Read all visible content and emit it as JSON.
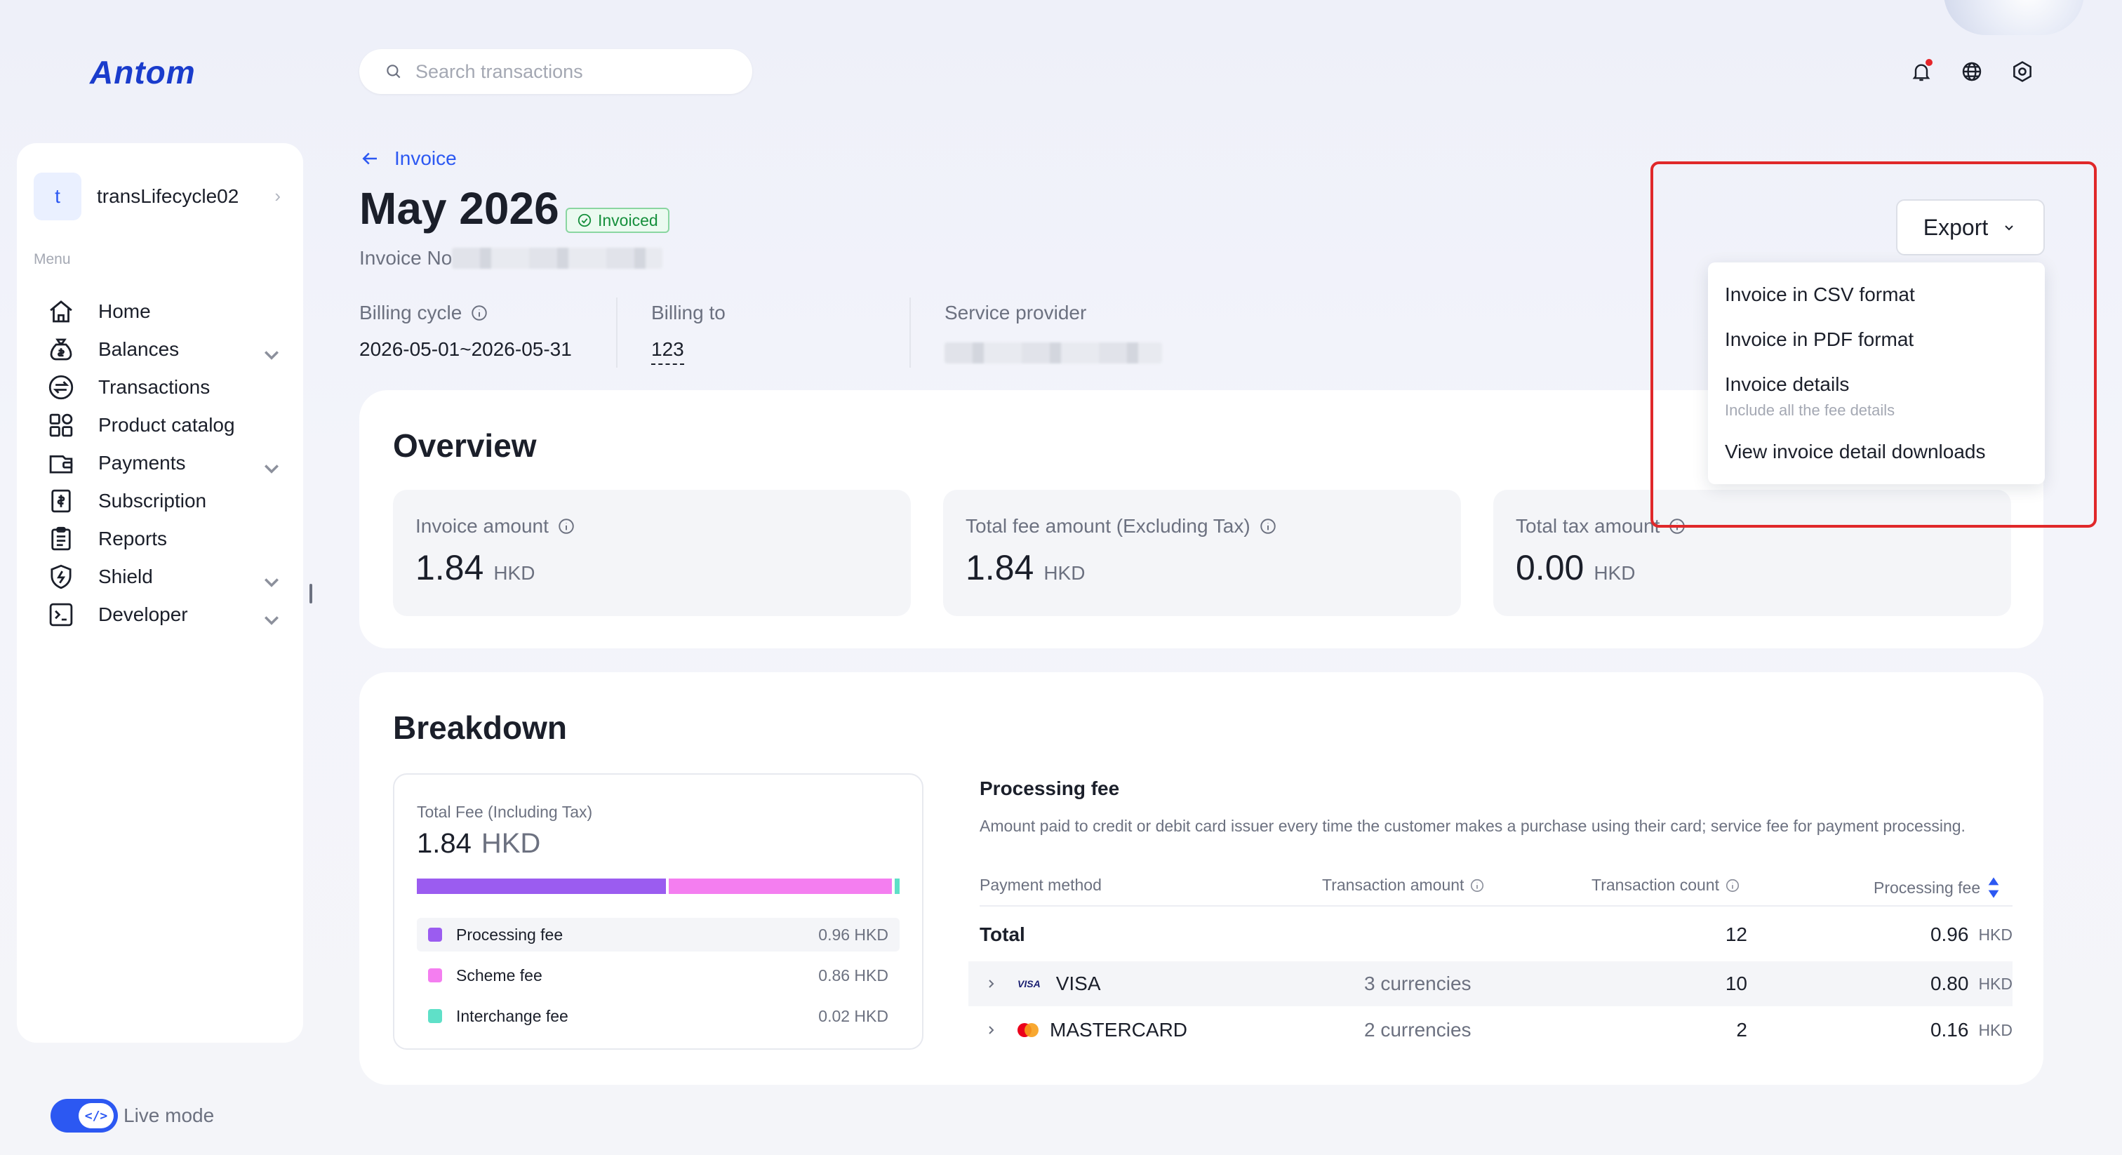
{
  "app": {
    "logo_text": "Antom"
  },
  "header": {
    "search_placeholder": "Search transactions",
    "icons": [
      "bell-icon",
      "globe-icon",
      "gear-icon"
    ]
  },
  "sidebar": {
    "account_initial": "t",
    "account_name": "transLifecycle02",
    "menu_label": "Menu",
    "items": [
      {
        "label": "Home",
        "icon": "home-icon",
        "expandable": false
      },
      {
        "label": "Balances",
        "icon": "balances-icon",
        "expandable": true
      },
      {
        "label": "Transactions",
        "icon": "transactions-icon",
        "expandable": false
      },
      {
        "label": "Product catalog",
        "icon": "catalog-icon",
        "expandable": false
      },
      {
        "label": "Payments",
        "icon": "payments-icon",
        "expandable": true
      },
      {
        "label": "Subscription",
        "icon": "subscription-icon",
        "expandable": false
      },
      {
        "label": "Reports",
        "icon": "reports-icon",
        "expandable": false
      },
      {
        "label": "Shield",
        "icon": "shield-icon",
        "expandable": true
      },
      {
        "label": "Developer",
        "icon": "developer-icon",
        "expandable": true
      }
    ],
    "live_mode_label": "Live mode",
    "live_mode_on": true
  },
  "page": {
    "back_label": "Invoice",
    "title": "May 2026",
    "status_badge": "Invoiced",
    "invoice_no_label": "Invoice No",
    "billing_cycle_label": "Billing cycle",
    "billing_cycle_value": "2026-05-01~2026-05-31",
    "billing_to_label": "Billing to",
    "billing_to_value": "123",
    "service_provider_label": "Service provider"
  },
  "export": {
    "button_label": "Export",
    "menu": [
      {
        "label": "Invoice in CSV format"
      },
      {
        "label": "Invoice in PDF format"
      },
      {
        "label": "Invoice details",
        "sublabel": "Include all the fee details"
      },
      {
        "label": "View invoice detail downloads"
      }
    ]
  },
  "overview": {
    "title": "Overview",
    "stats": [
      {
        "label": "Invoice amount",
        "value": "1.84",
        "currency": "HKD"
      },
      {
        "label": "Total fee amount (Excluding Tax)",
        "value": "1.84",
        "currency": "HKD"
      },
      {
        "label": "Total tax amount",
        "value": "0.00",
        "currency": "HKD"
      }
    ]
  },
  "breakdown": {
    "title": "Breakdown",
    "total_fee_label": "Total Fee (Including Tax)",
    "total_fee_value": "1.84",
    "total_fee_currency": "HKD",
    "fees": [
      {
        "name": "Processing fee",
        "amount": "0.96 HKD",
        "share": 0.5217,
        "color": "#9b5cf0"
      },
      {
        "name": "Scheme fee",
        "amount": "0.86 HKD",
        "share": 0.4674,
        "color": "#f47ef0"
      },
      {
        "name": "Interchange fee",
        "amount": "0.02 HKD",
        "share": 0.0109,
        "color": "#5fe0c8"
      }
    ],
    "processing_fee": {
      "title": "Processing fee",
      "description": "Amount paid to credit or debit card issuer every time the customer makes a purchase using their card; service fee for payment processing.",
      "columns": [
        "Payment method",
        "Transaction amount",
        "Transaction count",
        "Processing fee"
      ],
      "total_row": {
        "label": "Total",
        "count": "12",
        "fee": "0.96",
        "currency": "HKD"
      },
      "rows": [
        {
          "method": "VISA",
          "amount": "3 currencies",
          "count": "10",
          "fee": "0.80",
          "currency": "HKD"
        },
        {
          "method": "MASTERCARD",
          "amount": "2 currencies",
          "count": "2",
          "fee": "0.16",
          "currency": "HKD"
        }
      ]
    }
  }
}
